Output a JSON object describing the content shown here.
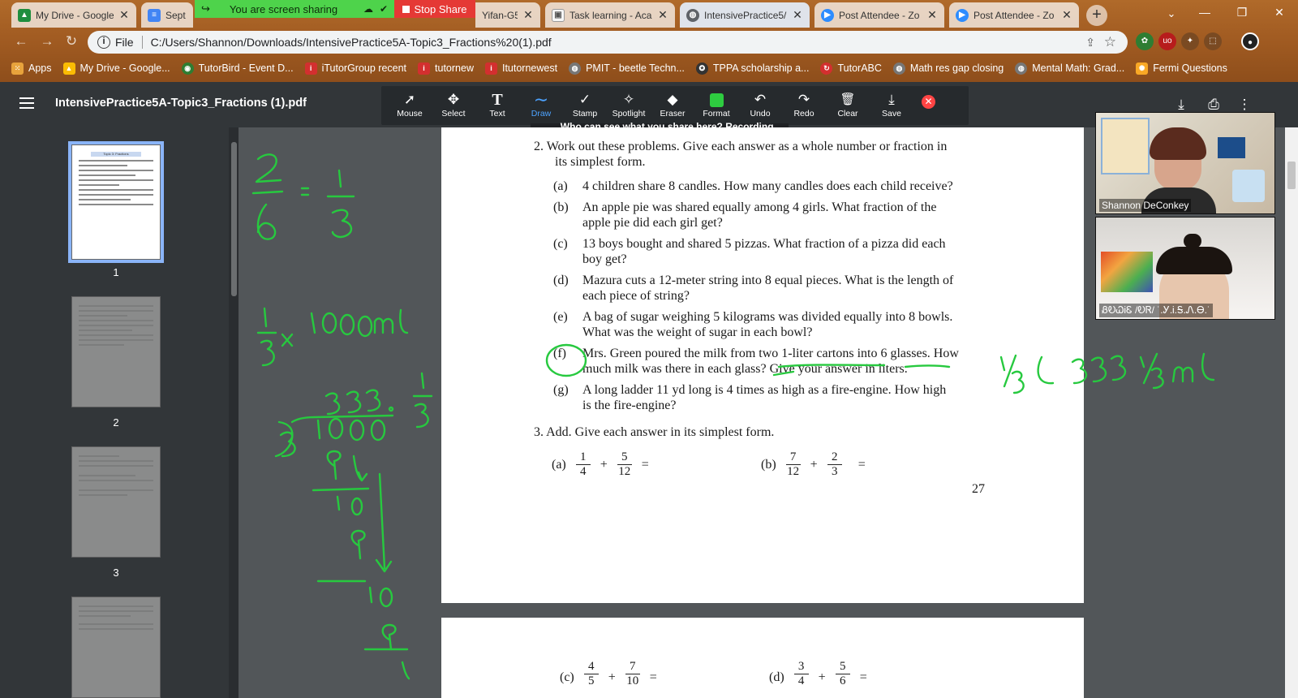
{
  "browser": {
    "tabs": [
      {
        "title": "My Drive - Google",
        "icon": "google-drive-icon",
        "color": "#1e8e3e"
      },
      {
        "title": "Sept",
        "icon": "google-docs-icon",
        "color": "#4285f4"
      },
      {
        "title": "Yifan-G5",
        "icon": "generic-page-icon",
        "color": "#777777"
      },
      {
        "title": "Task learning - Aca",
        "icon": "task-icon",
        "color": "#5f6368"
      },
      {
        "title": "IntensivePractice5/",
        "icon": "globe-icon",
        "color": "#5f6368"
      },
      {
        "title": "Post Attendee - Zo",
        "icon": "zoom-icon",
        "color": "#2d8cff"
      },
      {
        "title": "Post Attendee - Zo",
        "icon": "zoom-icon",
        "color": "#2d8cff"
      }
    ],
    "new_tab": "+",
    "window_controls": {
      "minimize": "—",
      "restore": "❐",
      "close": "✕",
      "search": "⌄"
    },
    "share_banner": "You are screen sharing",
    "stop_share": "Stop Share",
    "address": {
      "scheme": "File",
      "url": "C:/Users/Shannon/Downloads/IntensivePractice5A-Topic3_Fractions%20(1).pdf"
    },
    "bookmarks": [
      {
        "label": "Apps",
        "icon": "apps-grid-icon",
        "color": "#e8a33c"
      },
      {
        "label": "My Drive - Google...",
        "icon": "google-drive-icon",
        "color": "#fbbc04"
      },
      {
        "label": "TutorBird - Event D...",
        "icon": "tutorbird-icon",
        "color": "#2e7d32"
      },
      {
        "label": "iTutorGroup recent",
        "icon": "itutor-icon",
        "color": "#d32f2f"
      },
      {
        "label": "tutornew",
        "icon": "itutor-icon",
        "color": "#d32f2f"
      },
      {
        "label": "Itutornewest",
        "icon": "itutor-icon",
        "color": "#d32f2f"
      },
      {
        "label": "PMIT - beetle Techn...",
        "icon": "generic-page-icon",
        "color": "#777777"
      },
      {
        "label": "TPPA scholarship a...",
        "icon": "badge-icon",
        "color": "#333333"
      },
      {
        "label": "TutorABC",
        "icon": "refresh-logo-icon",
        "color": "#d32f2f"
      },
      {
        "label": "Math res gap closing",
        "icon": "globe-icon",
        "color": "#777777"
      },
      {
        "label": "Mental Math: Grad...",
        "icon": "generic-page-icon",
        "color": "#777777"
      },
      {
        "label": "Fermi Questions",
        "icon": "bulb-icon",
        "color": "#f9a825"
      }
    ]
  },
  "pdf": {
    "title": "IntensivePractice5A-Topic3_Fractions (1).pdf",
    "thumbnails": [
      {
        "page": "1"
      },
      {
        "page": "2"
      },
      {
        "page": "3"
      }
    ],
    "thumb_title": "Topic 3: Fractions"
  },
  "annotate": {
    "tools": [
      {
        "label": "Mouse",
        "icon": "mouse-pointer-icon",
        "glyph": "➚"
      },
      {
        "label": "Select",
        "icon": "move-icon",
        "glyph": "✥"
      },
      {
        "label": "Text",
        "icon": "text-icon",
        "glyph": "T"
      },
      {
        "label": "Draw",
        "icon": "pen-squiggle-icon",
        "glyph": "∼"
      },
      {
        "label": "Stamp",
        "icon": "checkmark-icon",
        "glyph": "✓"
      },
      {
        "label": "Spotlight",
        "icon": "spotlight-wand-icon",
        "glyph": "✧"
      },
      {
        "label": "Eraser",
        "icon": "eraser-icon",
        "glyph": "◆"
      },
      {
        "label": "Format",
        "icon": "color-swatch-icon",
        "glyph": ""
      },
      {
        "label": "Undo",
        "icon": "undo-icon",
        "glyph": "↶"
      },
      {
        "label": "Redo",
        "icon": "redo-icon",
        "glyph": "↷"
      },
      {
        "label": "Clear",
        "icon": "trash-icon",
        "glyph": "🗑"
      },
      {
        "label": "Save",
        "icon": "save-download-icon",
        "glyph": "⤓"
      }
    ],
    "selected": "Draw",
    "ink_color": "#27c93f",
    "recording_banner": "Who can see what you share here? Recording On"
  },
  "document": {
    "q2_intro": [
      "2.  Work out these problems.  Give each answer as a whole number or fraction in",
      "its simplest form."
    ],
    "q2_items": [
      {
        "label": "(a)",
        "lines": [
          "4 children share 8 candles. How many candles does each child receive?"
        ]
      },
      {
        "label": "(b)",
        "lines": [
          "An apple pie was shared equally among 4 girls. What fraction of the",
          "apple pie did each girl get?"
        ]
      },
      {
        "label": "(c)",
        "lines": [
          "13 boys bought and shared 5 pizzas. What fraction of a pizza did each",
          "boy get?"
        ]
      },
      {
        "label": "(d)",
        "lines": [
          "Mazura cuts a 12-meter string into 8 equal pieces. What is the length of",
          "each piece of string?"
        ]
      },
      {
        "label": "(e)",
        "lines": [
          "A bag of sugar weighing 5 kilograms was divided equally into 8 bowls.",
          "What was the weight of sugar in each bowl?"
        ]
      },
      {
        "label": "(f)",
        "lines": [
          "Mrs. Green poured the milk from two 1-liter cartons into 6 glasses. How",
          "much milk was there in each glass? Give your answer in liters."
        ]
      },
      {
        "label": "(g)",
        "lines": [
          "A long ladder 11 yd long is 4 times as high as a fire-engine. How high",
          "is the fire-engine?"
        ]
      }
    ],
    "q3_intro": "3.  Add. Give each answer in its simplest form.",
    "q3_items": [
      {
        "label": "(a)",
        "a": {
          "n": "1",
          "d": "4"
        },
        "b": {
          "n": "5",
          "d": "12"
        }
      },
      {
        "label": "(b)",
        "a": {
          "n": "7",
          "d": "12"
        },
        "b": {
          "n": "2",
          "d": "3"
        }
      },
      {
        "label": "(c)",
        "a": {
          "n": "4",
          "d": "5"
        },
        "b": {
          "n": "7",
          "d": "10"
        }
      },
      {
        "label": "(d)",
        "a": {
          "n": "3",
          "d": "4"
        },
        "b": {
          "n": "5",
          "d": "6"
        }
      }
    ],
    "plus": "+",
    "equals": "=",
    "page_number": "27"
  },
  "ink": {
    "answer_f": "⅓ ℓ   333 ⅓ ml",
    "left_eq_top": "2/6 = 1/3",
    "left_eq_ml": "1/3 × 1000ml",
    "division": "333. 1/3  3)1000"
  },
  "participants": [
    {
      "name": "Shannon DeConkey"
    },
    {
      "name": "ᏰᎧᏇᎥᏋ /ᎧᏒ/ ˙.Ꭹ.Ꭵ.Ꭶ.Ꮑ.Ꮎ.˙"
    }
  ]
}
